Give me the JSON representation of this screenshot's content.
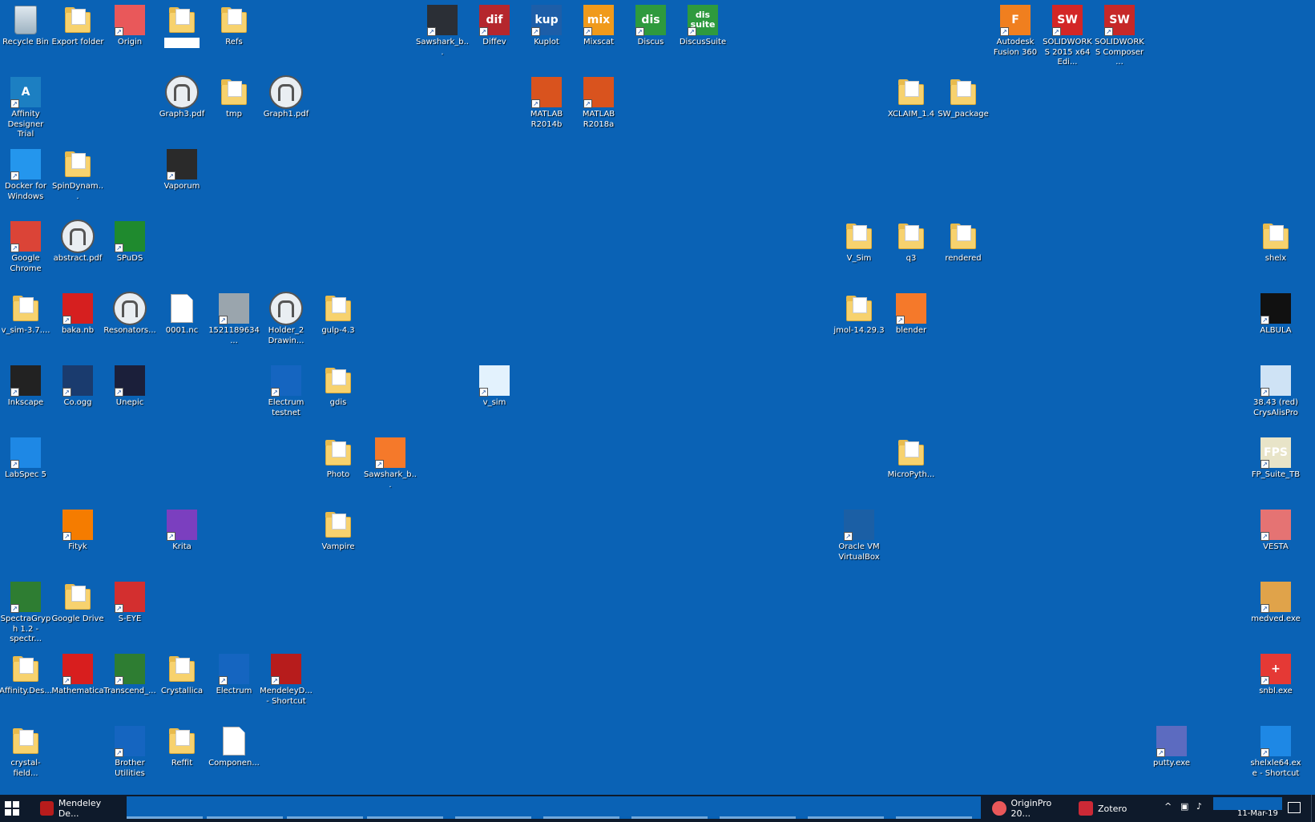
{
  "desktop": {
    "icons": [
      {
        "id": "recycle-bin",
        "label": "Recycle Bin",
        "kind": "bin"
      },
      {
        "id": "export-folder",
        "label": "Export folder",
        "kind": "folder"
      },
      {
        "id": "origin",
        "label": "Origin",
        "kind": "tile",
        "text": "",
        "color": "#e9585a"
      },
      {
        "id": "unnamed-folder",
        "label": "",
        "kind": "folder"
      },
      {
        "id": "refs",
        "label": "Refs",
        "kind": "folder"
      },
      {
        "id": "sawshark-1",
        "label": "Sawshark_b...",
        "kind": "tile",
        "text": "",
        "color": "#2b2f36"
      },
      {
        "id": "diffev",
        "label": "Diffev",
        "kind": "tile",
        "text": "dif",
        "color": "#b5272d"
      },
      {
        "id": "kuplot",
        "label": "Kuplot",
        "kind": "tile",
        "text": "kup",
        "color": "#1d5ea8"
      },
      {
        "id": "mixscat",
        "label": "Mixscat",
        "kind": "tile",
        "text": "mix",
        "color": "#f09a1b"
      },
      {
        "id": "discus",
        "label": "Discus",
        "kind": "tile",
        "text": "dis",
        "color": "#2e9a3e"
      },
      {
        "id": "discussuite",
        "label": "DiscusSuite",
        "kind": "tile",
        "text": "dis suite",
        "color": "#2e9a3e"
      },
      {
        "id": "autodesk-fusion",
        "label": "Autodesk Fusion 360",
        "kind": "tile",
        "text": "F",
        "color": "#f07f1f"
      },
      {
        "id": "solidworks-2015",
        "label": "SOLIDWORKS 2015 x64 Edi...",
        "kind": "tile",
        "text": "SW",
        "color": "#d32626"
      },
      {
        "id": "solidworks-composer",
        "label": "SOLIDWORKS Composer ...",
        "kind": "tile",
        "text": "SW",
        "color": "#c62828"
      },
      {
        "id": "affinity-designer-trial",
        "label": "Affinity Designer Trial",
        "kind": "tile",
        "text": "A",
        "color": "#1c7fc2"
      },
      {
        "id": "graph3",
        "label": "Graph3.pdf",
        "kind": "pdf"
      },
      {
        "id": "tmp",
        "label": "tmp",
        "kind": "folder"
      },
      {
        "id": "graph1",
        "label": "Graph1.pdf",
        "kind": "pdf"
      },
      {
        "id": "matlab-2014b",
        "label": "MATLAB R2014b",
        "kind": "tile",
        "text": "",
        "color": "#d9531e"
      },
      {
        "id": "matlab-2018a",
        "label": "MATLAB R2018a",
        "kind": "tile",
        "text": "",
        "color": "#d9531e"
      },
      {
        "id": "xclaim",
        "label": "XCLAIM_1.4",
        "kind": "folder"
      },
      {
        "id": "sw-package",
        "label": "SW_package",
        "kind": "folder"
      },
      {
        "id": "docker",
        "label": "Docker for Windows",
        "kind": "tile",
        "text": "",
        "color": "#2496ed"
      },
      {
        "id": "spindynam",
        "label": "SpinDynam...",
        "kind": "folder"
      },
      {
        "id": "vaporum",
        "label": "Vaporum",
        "kind": "tile",
        "text": "",
        "color": "#2a2a2a"
      },
      {
        "id": "google-chrome",
        "label": "Google Chrome",
        "kind": "tile",
        "text": "",
        "color": "#db4437"
      },
      {
        "id": "abstract-pdf",
        "label": "abstract.pdf",
        "kind": "pdf"
      },
      {
        "id": "spuds",
        "label": "SPuDS",
        "kind": "tile",
        "text": "",
        "color": "#1f8a2e"
      },
      {
        "id": "v-sim-folder",
        "label": "V_Sim",
        "kind": "folder"
      },
      {
        "id": "q3",
        "label": "q3",
        "kind": "folder"
      },
      {
        "id": "rendered",
        "label": "rendered",
        "kind": "folder"
      },
      {
        "id": "shelx",
        "label": "shelx",
        "kind": "folder"
      },
      {
        "id": "v-sim-37",
        "label": "v_sim-3.7....",
        "kind": "folder"
      },
      {
        "id": "baka-nb",
        "label": "baka.nb",
        "kind": "tile",
        "text": "",
        "color": "#d61f1f"
      },
      {
        "id": "resonators",
        "label": "Resonators...",
        "kind": "pdf"
      },
      {
        "id": "file-0001",
        "label": "0001.nc",
        "kind": "file"
      },
      {
        "id": "img-1521",
        "label": "1521189634...",
        "kind": "tile",
        "text": "",
        "color": "#9aa5ad"
      },
      {
        "id": "holder2",
        "label": "Holder_2 Drawin...",
        "kind": "pdf"
      },
      {
        "id": "gulp",
        "label": "gulp-4.3",
        "kind": "folder"
      },
      {
        "id": "jmol",
        "label": "jmol-14.29.3",
        "kind": "folder"
      },
      {
        "id": "blender",
        "label": "blender",
        "kind": "tile",
        "text": "",
        "color": "#f5792a"
      },
      {
        "id": "albula",
        "label": "ALBULA",
        "kind": "tile",
        "text": "",
        "color": "#111"
      },
      {
        "id": "inkscape",
        "label": "Inkscape",
        "kind": "tile",
        "text": "",
        "color": "#222"
      },
      {
        "id": "co-ogg",
        "label": "Co.ogg",
        "kind": "tile",
        "text": "",
        "color": "#1a3b6e"
      },
      {
        "id": "unepic",
        "label": "Unepic",
        "kind": "tile",
        "text": "",
        "color": "#1b1f3a"
      },
      {
        "id": "electrum-testnet",
        "label": "Electrum testnet",
        "kind": "tile",
        "text": "",
        "color": "#1565c0"
      },
      {
        "id": "gdis",
        "label": "gdis",
        "kind": "folder"
      },
      {
        "id": "v-sim-app",
        "label": "v_sim",
        "kind": "tile",
        "text": "",
        "color": "#e3f2fd"
      },
      {
        "id": "crysalis",
        "label": "38.43 (red) CrysAlisPro",
        "kind": "tile",
        "text": "",
        "color": "#cfe3f5"
      },
      {
        "id": "labspec",
        "label": "LabSpec 5",
        "kind": "tile",
        "text": "",
        "color": "#1e88e5"
      },
      {
        "id": "photo",
        "label": "Photo",
        "kind": "folder"
      },
      {
        "id": "sawshark-2",
        "label": "Sawshark_b...",
        "kind": "tile",
        "text": "",
        "color": "#f5792a"
      },
      {
        "id": "micropyth",
        "label": "MicroPyth...",
        "kind": "folder"
      },
      {
        "id": "fp-suite",
        "label": "FP_Suite_TB",
        "kind": "tile",
        "text": "FPS",
        "color": "#e8e4c8"
      },
      {
        "id": "fityk",
        "label": "Fityk",
        "kind": "tile",
        "text": "",
        "color": "#f57c00"
      },
      {
        "id": "krita",
        "label": "Krita",
        "kind": "tile",
        "text": "",
        "color": "#7b3fbf"
      },
      {
        "id": "vampire",
        "label": "Vampire",
        "kind": "folder"
      },
      {
        "id": "virtualbox",
        "label": "Oracle VM VirtualBox",
        "kind": "tile",
        "text": "",
        "color": "#1b5fa5"
      },
      {
        "id": "vesta",
        "label": "VESTA",
        "kind": "tile",
        "text": "",
        "color": "#e57373"
      },
      {
        "id": "spectragryph",
        "label": "SpectraGryph 1.2 - spectr...",
        "kind": "tile",
        "text": "",
        "color": "#2e7d32"
      },
      {
        "id": "google-drive",
        "label": "Google Drive",
        "kind": "folder"
      },
      {
        "id": "s-eye",
        "label": "S-EYE",
        "kind": "tile",
        "text": "",
        "color": "#d32f2f"
      },
      {
        "id": "medved",
        "label": "medved.exe",
        "kind": "tile",
        "text": "",
        "color": "#e0a34a"
      },
      {
        "id": "affinity-des",
        "label": "Affinity.Des...",
        "kind": "folder"
      },
      {
        "id": "mathematica",
        "label": "Mathematica",
        "kind": "tile",
        "text": "",
        "color": "#d81e1e"
      },
      {
        "id": "transcend",
        "label": "Transcend_...",
        "kind": "tile",
        "text": "",
        "color": "#2e7d32"
      },
      {
        "id": "crystallica",
        "label": "Crystallica",
        "kind": "folder"
      },
      {
        "id": "electrum",
        "label": "Electrum",
        "kind": "tile",
        "text": "",
        "color": "#1565c0"
      },
      {
        "id": "mendeley-shortcut",
        "label": "MendeleyD... - Shortcut",
        "kind": "tile",
        "text": "",
        "color": "#b71c1c"
      },
      {
        "id": "snbl",
        "label": "snbl.exe",
        "kind": "tile",
        "text": "+",
        "color": "#e53935"
      },
      {
        "id": "crystal-field",
        "label": "crystal-field...",
        "kind": "folder"
      },
      {
        "id": "brother",
        "label": "Brother Utilities",
        "kind": "tile",
        "text": "",
        "color": "#1565c0"
      },
      {
        "id": "reffit",
        "label": "Reffit",
        "kind": "folder"
      },
      {
        "id": "componen",
        "label": "Componen...",
        "kind": "file"
      },
      {
        "id": "putty",
        "label": "putty.exe",
        "kind": "tile",
        "text": "",
        "color": "#5c6bc0"
      },
      {
        "id": "shelxle",
        "label": "shelxle64.exe - Shortcut",
        "kind": "tile",
        "text": "",
        "color": "#1e88e5"
      }
    ]
  },
  "taskbar": {
    "buttons": [
      {
        "id": "mendeley",
        "label": "Mendeley De...",
        "color": "#b71c1c"
      },
      {
        "id": "originpro",
        "label": "OriginPro 20...",
        "color": "#e9585a"
      },
      {
        "id": "zotero",
        "label": "Zotero",
        "color": "#cc2936"
      }
    ],
    "clock": "11-Mar-19"
  }
}
